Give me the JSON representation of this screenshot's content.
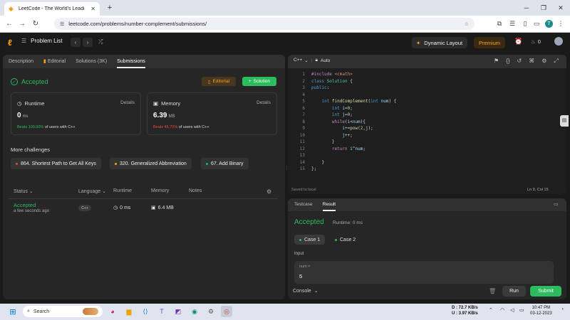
{
  "browser": {
    "tab_title": "LeetCode - The World's Leadi",
    "url": "leetcode.com/problems/number-complement/submissions/",
    "profile_initial": "T"
  },
  "header": {
    "problem_list": "Problem List",
    "dynamic_layout": "Dynamic Layout",
    "premium": "Premium",
    "streak": "0"
  },
  "left_tabs": [
    "Description",
    "Editorial",
    "Solutions (3K)",
    "Submissions"
  ],
  "status": {
    "accepted": "Accepted",
    "editorial_btn": "Editorial",
    "solution_btn": "Solution"
  },
  "runtime": {
    "label": "Runtime",
    "details": "Details",
    "value": "0",
    "unit": "ms",
    "beats_prefix": "Beats 100.00%",
    "beats_suffix": "of users with C++"
  },
  "memory": {
    "label": "Memory",
    "details": "Details",
    "value": "6.39",
    "unit": "MB",
    "beats_prefix": "Beats 45.70%",
    "beats_suffix": "of users with C++"
  },
  "more_challenges": {
    "title": "More challenges",
    "items": [
      {
        "label": "864. Shortest Path to Get All Keys",
        "color": "#ef4743"
      },
      {
        "label": "320. Generalized Abbreviation",
        "color": "#ffa116"
      },
      {
        "label": "67. Add Binary",
        "color": "#00b8a3"
      }
    ]
  },
  "submissions_table": {
    "headers": [
      "Status",
      "Language",
      "Runtime",
      "Memory",
      "Notes"
    ],
    "row": {
      "status": "Accepted",
      "time": "a few seconds ago",
      "language": "C++",
      "runtime": "0 ms",
      "memory": "6.4 MB"
    }
  },
  "editor": {
    "language": "C++",
    "autosave": "Auto",
    "saved": "Saved to local",
    "position": "Ln 9, Col 15"
  },
  "result": {
    "tabs": [
      "Testcase",
      "Result"
    ],
    "status": "Accepted",
    "runtime": "Runtime: 0 ms",
    "cases": [
      "Case 1",
      "Case 2"
    ],
    "input_label": "Input",
    "param_name": "num =",
    "param_value": "5",
    "console": "Console",
    "run": "Run",
    "submit": "Submit"
  },
  "taskbar": {
    "search": "Search",
    "net_down": "D : 72.7 KB/s",
    "net_up": "U : 3.97 KB/s",
    "time": "10:47 PM",
    "date": "03-12-2023"
  },
  "colors": {
    "accent": "#ffa116",
    "success": "#2cbb5d",
    "danger": "#ef4743"
  }
}
